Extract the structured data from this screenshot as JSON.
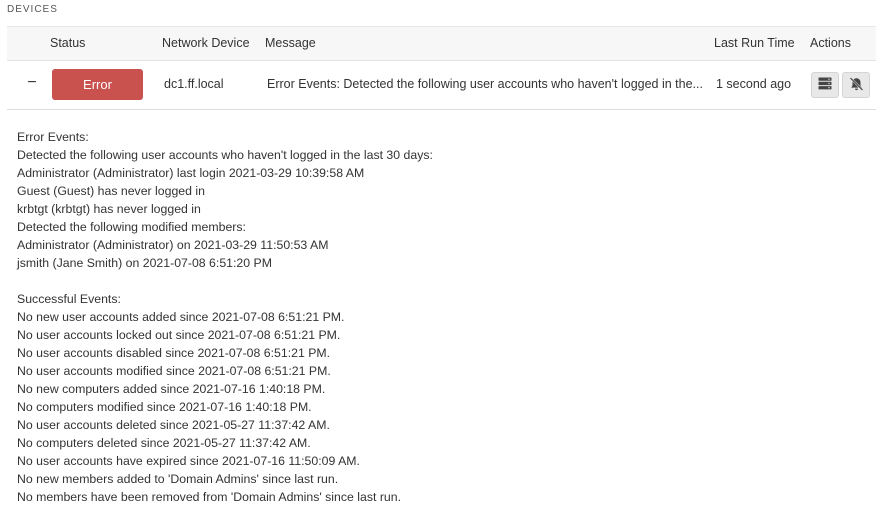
{
  "section": {
    "title": "DEVICES"
  },
  "table": {
    "headers": {
      "status": "Status",
      "device": "Network Device",
      "message": "Message",
      "last_run": "Last Run Time",
      "actions": "Actions"
    },
    "row": {
      "collapse_symbol": "−",
      "status": "Error",
      "device": "dc1.ff.local",
      "message": "Error Events: Detected the following user accounts who haven't logged in the...",
      "last_run": "1 second ago",
      "actions": [
        {
          "icon": "server-icon"
        },
        {
          "icon": "bell-slash-icon"
        }
      ]
    }
  },
  "details": {
    "error_lines": [
      "Error Events:",
      "Detected the following user accounts who haven't logged in the last 30 days:",
      "Administrator (Administrator) last login 2021-03-29 10:39:58 AM",
      "Guest (Guest) has never logged in",
      "krbtgt (krbtgt) has never logged in",
      "Detected the following modified members:",
      "Administrator (Administrator) on 2021-03-29 11:50:53 AM",
      "jsmith (Jane Smith) on 2021-07-08 6:51:20 PM"
    ],
    "success_lines": [
      "Successful Events:",
      "No new user accounts added since 2021-07-08 6:51:21 PM.",
      "No user accounts locked out since 2021-07-08 6:51:21 PM.",
      "No user accounts disabled since 2021-07-08 6:51:21 PM.",
      "No user accounts modified since 2021-07-08 6:51:21 PM.",
      "No new computers added since 2021-07-16 1:40:18 PM.",
      "No computers modified since 2021-07-16 1:40:18 PM.",
      "No user accounts deleted since 2021-05-27 11:37:42 AM.",
      "No computers deleted since 2021-05-27 11:37:42 AM.",
      "No user accounts have expired since 2021-07-16 11:50:09 AM.",
      "No new members added to 'Domain Admins' since last run.",
      "No members have been removed from 'Domain Admins' since last run."
    ]
  },
  "colors": {
    "error": "#c9524e",
    "header_bg": "#f7f7f7",
    "button_bg": "#e8e8e8"
  }
}
